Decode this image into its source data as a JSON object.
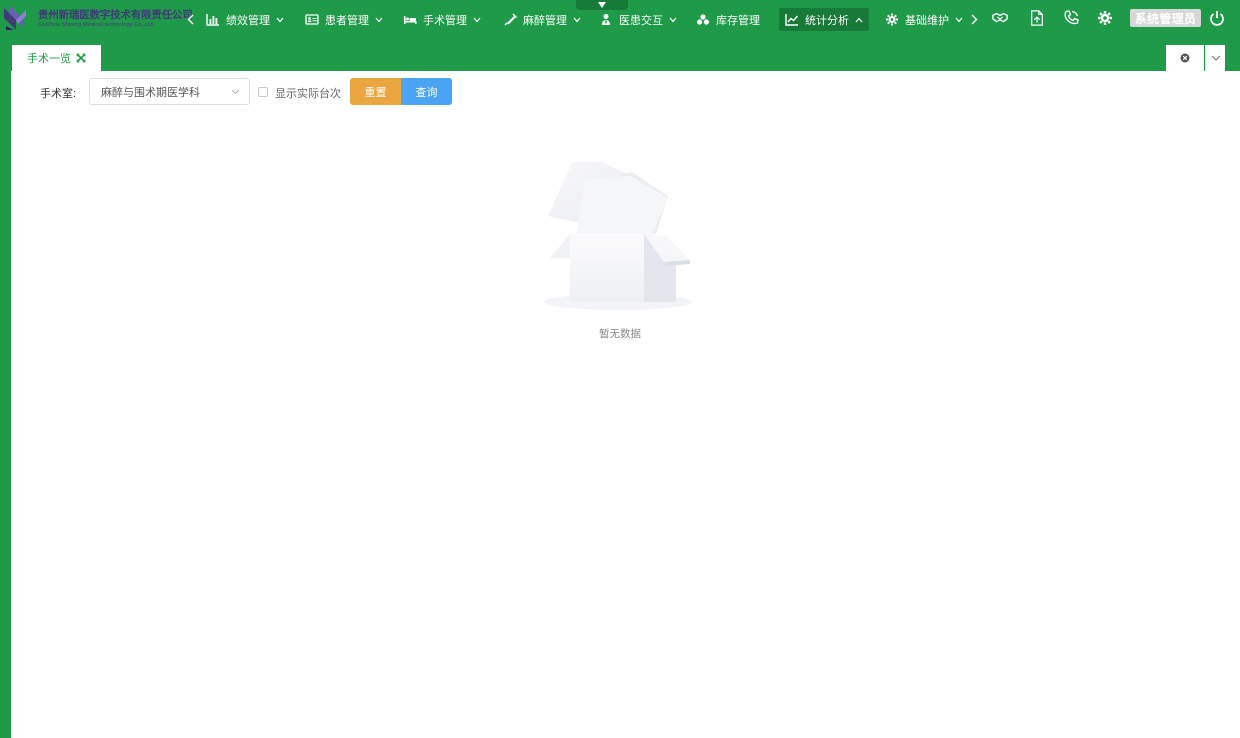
{
  "company": {
    "name_cn": "贵州新瑞医数字技术有限责任公司",
    "name_en": "GuiZhou Shining Medical technology Co.,Ltd"
  },
  "nav": {
    "items": [
      {
        "label": "绩效管理",
        "icon": "bar-chart-icon",
        "dropdown": true,
        "active": false
      },
      {
        "label": "患者管理",
        "icon": "id-card-icon",
        "dropdown": true,
        "active": false
      },
      {
        "label": "手术管理",
        "icon": "bed-icon",
        "dropdown": true,
        "active": false
      },
      {
        "label": "麻醉管理",
        "icon": "syringe-icon",
        "dropdown": true,
        "active": false
      },
      {
        "label": "医患交互",
        "icon": "user-doctor-icon",
        "dropdown": true,
        "active": false
      },
      {
        "label": "库存管理",
        "icon": "cubes-icon",
        "dropdown": false,
        "active": false
      },
      {
        "label": "统计分析",
        "icon": "line-chart-icon",
        "dropdown": true,
        "active": true
      },
      {
        "label": "基础维护",
        "icon": "gear-icon",
        "dropdown": true,
        "active": false
      }
    ]
  },
  "toolbar": {
    "icons": [
      "handshake-icon",
      "file-export-icon",
      "phone-icon",
      "settings-icon",
      "power-icon"
    ],
    "user_label": "系统管理员"
  },
  "tabs": [
    {
      "label": "手术一览",
      "active": true
    }
  ],
  "filter": {
    "room_label": "手术室:",
    "room_value": "麻醉与围术期医学科",
    "show_actual_label": "显示实际台次",
    "show_actual_checked": false,
    "reset_label": "重置",
    "query_label": "查询"
  },
  "empty": {
    "text": "暂无数据"
  },
  "colors": {
    "brand_green": "#1f9a49",
    "active_menu": "#177a38",
    "reset_button": "#eba63f",
    "query_button": "#4aa4f3",
    "logo_purple": "#3f3a78"
  }
}
